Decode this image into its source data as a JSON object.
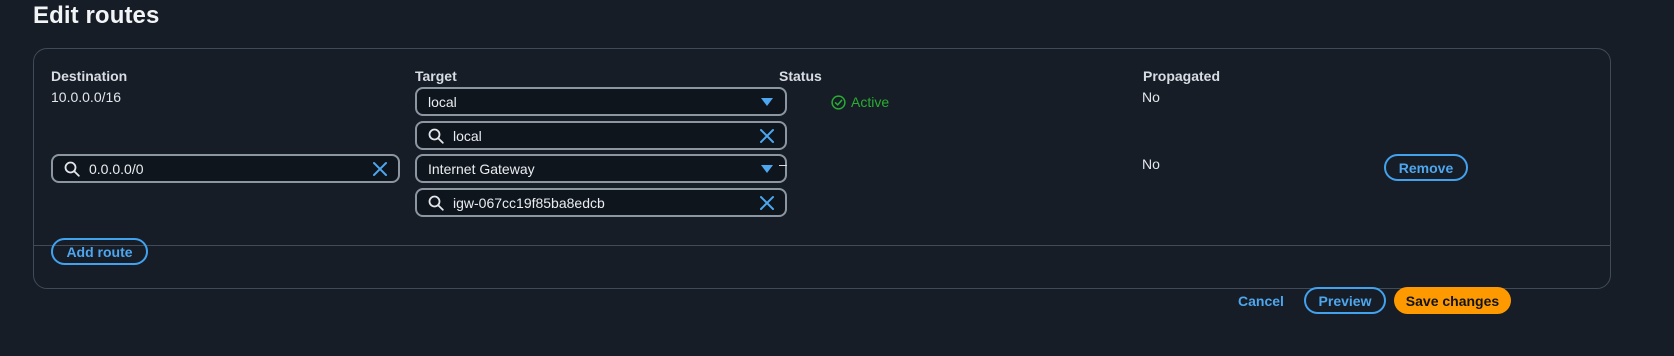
{
  "page": {
    "title": "Edit routes"
  },
  "columns": {
    "destination": "Destination",
    "target": "Target",
    "status": "Status",
    "propagated": "Propagated"
  },
  "routes": [
    {
      "destination": "10.0.0.0/16",
      "target_select": "local",
      "target_search": "local",
      "status": "Active",
      "propagated": "No"
    },
    {
      "destination_input": "0.0.0.0/0",
      "target_select": "Internet Gateway",
      "target_search": "igw-067cc19f85ba8edcb",
      "status": "–",
      "propagated": "No",
      "remove_label": "Remove"
    }
  ],
  "actions": {
    "add_route": "Add route",
    "cancel": "Cancel",
    "preview": "Preview",
    "save": "Save changes"
  },
  "icons": {
    "search": "search-icon",
    "clear": "close-icon",
    "caret": "caret-down-icon",
    "status_ok": "check-circle-icon"
  },
  "colors": {
    "background": "#161d27",
    "accent": "#4ea6ee",
    "success": "#29ad32",
    "primary_button": "#ff9900"
  }
}
